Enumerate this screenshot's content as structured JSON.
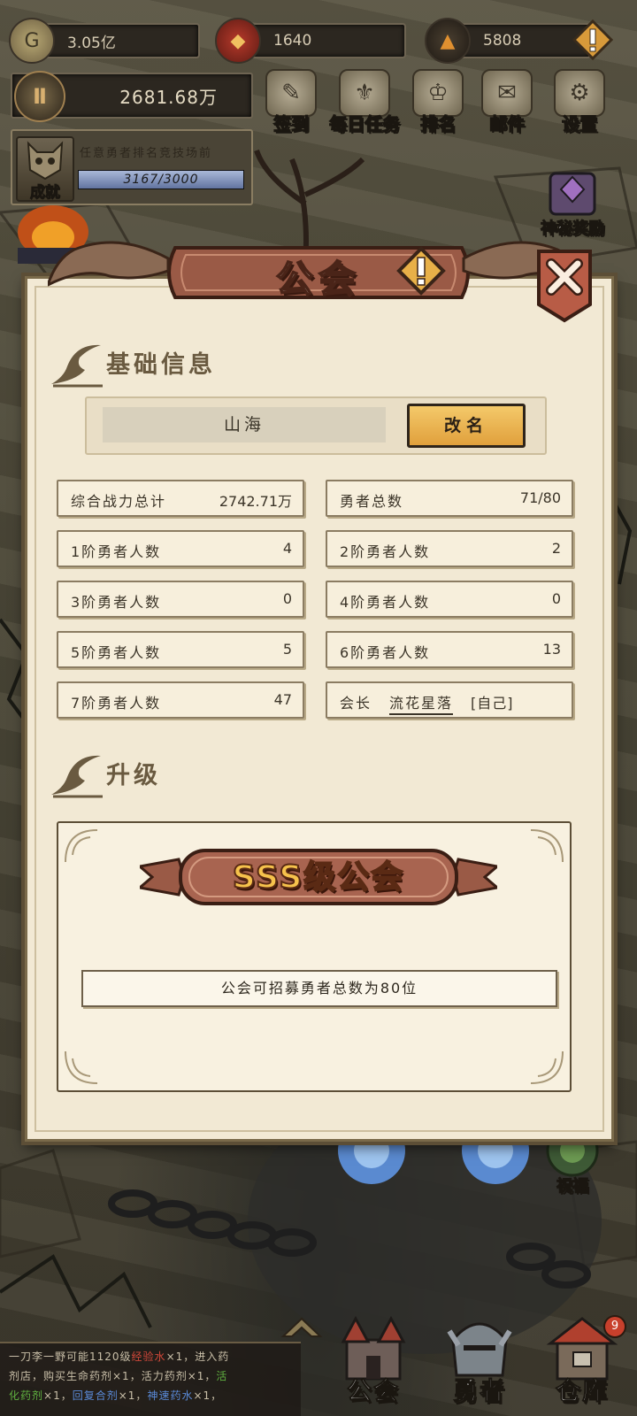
{
  "resources": {
    "gold": "3.05亿",
    "gems": "1640",
    "dark": "5808"
  },
  "power": "2681.68万",
  "nav": [
    {
      "label": "签到",
      "icon": "feather-book-icon"
    },
    {
      "label": "每日任务",
      "icon": "scroll-icon"
    },
    {
      "label": "排名",
      "icon": "helmet-icon"
    },
    {
      "label": "邮件",
      "icon": "envelope-icon"
    },
    {
      "label": "设置",
      "icon": "gear-icon"
    }
  ],
  "achievement": {
    "tag": "成就",
    "desc": "任意勇者排名竞技场前",
    "progress_text": "3167/3000",
    "progress": 1.0
  },
  "side": {
    "mystery_reward": "神秘奖励",
    "blessing": "祝福"
  },
  "guild": {
    "title": "公会",
    "basic_info_title": "基础信息",
    "name": "山海",
    "rename_label": "改名",
    "stats": [
      {
        "k": "综合战力总计",
        "v": "2742.71万"
      },
      {
        "k": "勇者总数",
        "v": "71/80"
      },
      {
        "k": "1阶勇者人数",
        "v": "4"
      },
      {
        "k": "2阶勇者人数",
        "v": "2"
      },
      {
        "k": "3阶勇者人数",
        "v": "0"
      },
      {
        "k": "4阶勇者人数",
        "v": "0"
      },
      {
        "k": "5阶勇者人数",
        "v": "5"
      },
      {
        "k": "6阶勇者人数",
        "v": "13"
      },
      {
        "k": "7阶勇者人数",
        "v": "47"
      }
    ],
    "leader": {
      "k": "会长",
      "name": "流花星落",
      "self": "[自己]"
    },
    "upgrade_title": "升级",
    "grade": "SSS级公会",
    "recruit_text": "公会可招募勇者总数为80位"
  },
  "ticker": {
    "line1a": "一刀李一野可能1120级",
    "line1b": "经验水",
    "line1c": "×1，进入药",
    "line2": "剂店，购买生命药剂×1，活力药剂×1，",
    "line2g": "活",
    "line3g": "化药剂",
    "line3a": "×1，",
    "line3b": "回复合剂",
    "line3c": "×1，",
    "line3d": "神速药水",
    "line3e": "×1，"
  },
  "bottom_nav": {
    "guild": "公会",
    "heroes": "勇者",
    "warehouse": "仓库",
    "warehouse_badge": "9"
  },
  "colors": {
    "panel": "#f2e9d4",
    "rename": "#f0b850",
    "grade_text": "#f6c24c",
    "title_banner": "#9a5a46"
  }
}
